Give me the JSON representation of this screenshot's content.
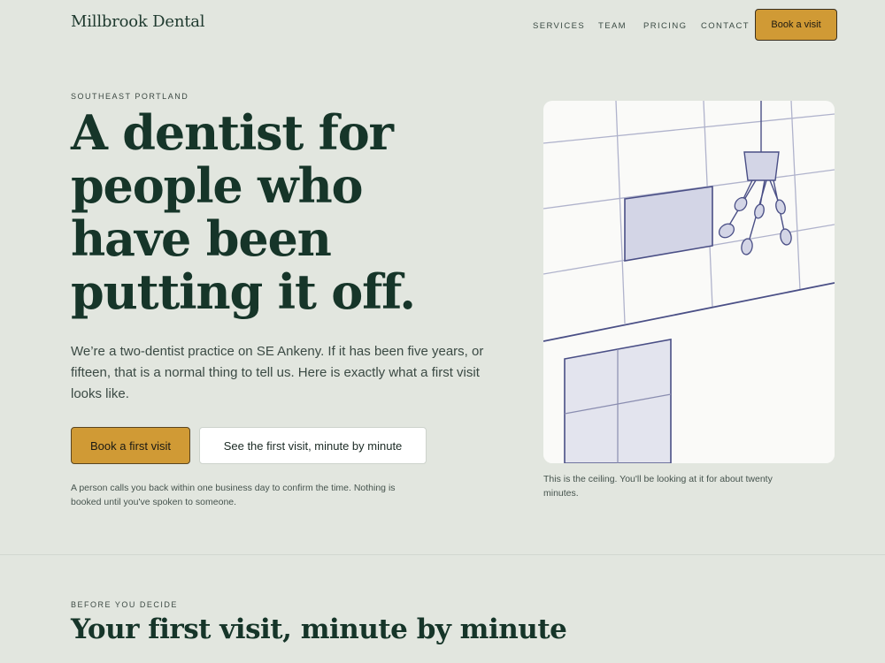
{
  "nav": {
    "brand": "Millbrook Dental",
    "links": [
      "SERVICES",
      "TEAM",
      "PRICING",
      "CONTACT"
    ],
    "cta": "Book a visit"
  },
  "hero": {
    "eyebrow": "SOUTHEAST PORTLAND",
    "title": "A dentist for people who have been putting it off.",
    "lede": "We’re a two-dentist practice on SE Ankeny. If it has been five years, or fifteen, that is a normal thing to tell us. Here is exactly what a first visit looks like.",
    "primary_cta": "Book a first visit",
    "secondary_cta": "See the first visit, minute by minute",
    "note": "A person calls you back within one business day to confirm the time. Nothing is booked until you've spoken to someone.",
    "caption": "This is the ceiling. You'll be looking at it for about twenty minutes."
  },
  "section": {
    "eyebrow": "BEFORE YOU DECIDE",
    "title": "Your first visit, minute by minute"
  },
  "colors": {
    "background": "#e2e6df",
    "accent": "#d09a35",
    "heading": "#163529",
    "illustration_line": "#4a4f86",
    "illustration_fill": "#d3d5e6"
  }
}
